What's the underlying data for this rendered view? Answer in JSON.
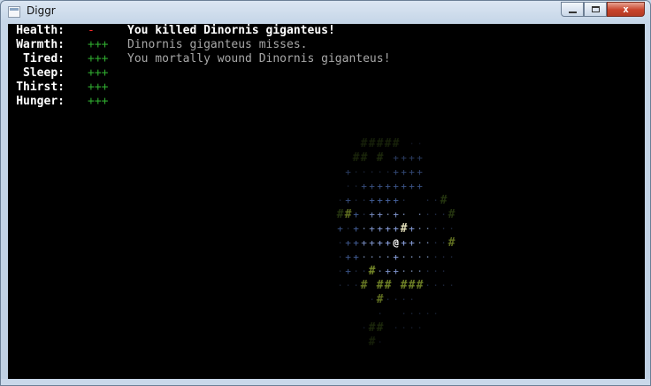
{
  "window": {
    "title": "Diggr",
    "icon": "console-window-icon"
  },
  "caption_buttons": [
    {
      "name": "minimize-button",
      "icon": "minimize-icon"
    },
    {
      "name": "maximize-button",
      "icon": "maximize-icon"
    },
    {
      "name": "close-button",
      "icon": "close-icon",
      "glyph": "x"
    }
  ],
  "stats": [
    {
      "label": "Health:",
      "value": "-",
      "color": "#ff2a2a"
    },
    {
      "label": "Warmth:",
      "value": "+++",
      "color": "#2faa2f"
    },
    {
      "label": "Tired:",
      "value": "+++",
      "color": "#2faa2f"
    },
    {
      "label": "Sleep:",
      "value": "+++",
      "color": "#2faa2f"
    },
    {
      "label": "Thirst:",
      "value": "+++",
      "color": "#2faa2f"
    },
    {
      "label": "Hunger:",
      "value": "+++",
      "color": "#2faa2f"
    }
  ],
  "messages": [
    {
      "text": "You killed Dinornis giganteus!",
      "style": "bold"
    },
    {
      "text": "Dinornis giganteus misses.",
      "style": "dim"
    },
    {
      "text": "You mortally wound Dinornis giganteus!",
      "style": "dim"
    }
  ],
  "map": {
    "player_glyph": "@",
    "legend": {
      "#": "wall",
      "+": "floor-lit",
      "·": "floor-dark",
      "@": "player"
    },
    "colors": {
      "wall_bright": "#9ab335",
      "wall_dim": "#3f5a1a",
      "floor_blue": "#5f86d8",
      "floor_dim": "#2f3f62",
      "player": "#ffffff",
      "highlight": "#fffbd0"
    },
    "rows": [
      "        ##### ··        ",
      "       ## # ++++        ",
      "      +·····++++        ",
      "      ··++++++++        ",
      "     ·+··++++·  ··#     ",
      "     ##+·++·+· ····#    ",
      "     +·+·++++#+·····    ",
      "     ·++++++@++····#    ",
      "     ·++····+·······    ",
      "     ·+··#·++······     ",
      "     ···# ## ###····    ",
      "         ·#····         ",
      "          ·  ·····      ",
      "        ·## ····        ",
      "         #·             "
    ]
  }
}
